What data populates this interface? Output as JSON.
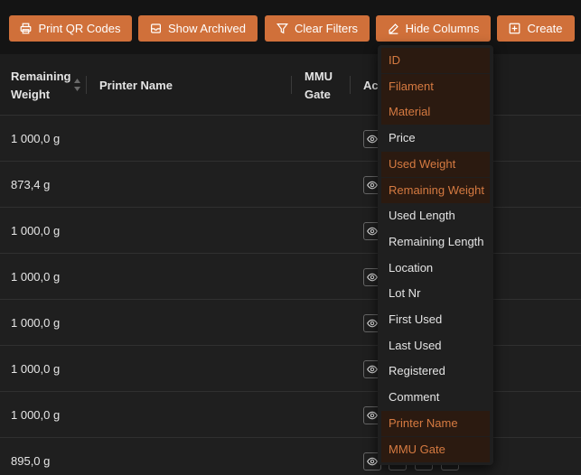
{
  "toolbar": {
    "print_qr": "Print QR Codes",
    "show_archived": "Show Archived",
    "clear_filters": "Clear Filters",
    "hide_columns": "Hide Columns",
    "create": "Create"
  },
  "table": {
    "headers": {
      "remaining_weight_line1": "Remaining",
      "remaining_weight_line2": "Weight",
      "printer_name": "Printer Name",
      "mmu_gate_line1": "MMU",
      "mmu_gate_line2": "Gate",
      "actions_partial": "Ac"
    },
    "rows": [
      {
        "remaining_weight": "1 000,0 g"
      },
      {
        "remaining_weight": "873,4 g"
      },
      {
        "remaining_weight": "1 000,0 g"
      },
      {
        "remaining_weight": "1 000,0 g"
      },
      {
        "remaining_weight": "1 000,0 g"
      },
      {
        "remaining_weight": "1 000,0 g"
      },
      {
        "remaining_weight": "1 000,0 g"
      },
      {
        "remaining_weight": "895,0 g"
      }
    ]
  },
  "column_menu": {
    "items": [
      {
        "label": "ID",
        "selected": true
      },
      {
        "label": "Filament",
        "selected": true
      },
      {
        "label": "Material",
        "selected": true
      },
      {
        "label": "Price",
        "selected": false
      },
      {
        "label": "Used Weight",
        "selected": true
      },
      {
        "label": "Remaining Weight",
        "selected": true
      },
      {
        "label": "Used Length",
        "selected": false
      },
      {
        "label": "Remaining Length",
        "selected": false
      },
      {
        "label": "Location",
        "selected": false
      },
      {
        "label": "Lot Nr",
        "selected": false
      },
      {
        "label": "First Used",
        "selected": false
      },
      {
        "label": "Last Used",
        "selected": false
      },
      {
        "label": "Registered",
        "selected": false
      },
      {
        "label": "Comment",
        "selected": false
      },
      {
        "label": "Printer Name",
        "selected": true
      },
      {
        "label": "MMU Gate",
        "selected": true
      }
    ]
  },
  "colors": {
    "accent": "#d0703a",
    "selected_text": "#d57a41",
    "selected_bg": "#2b1a10"
  }
}
